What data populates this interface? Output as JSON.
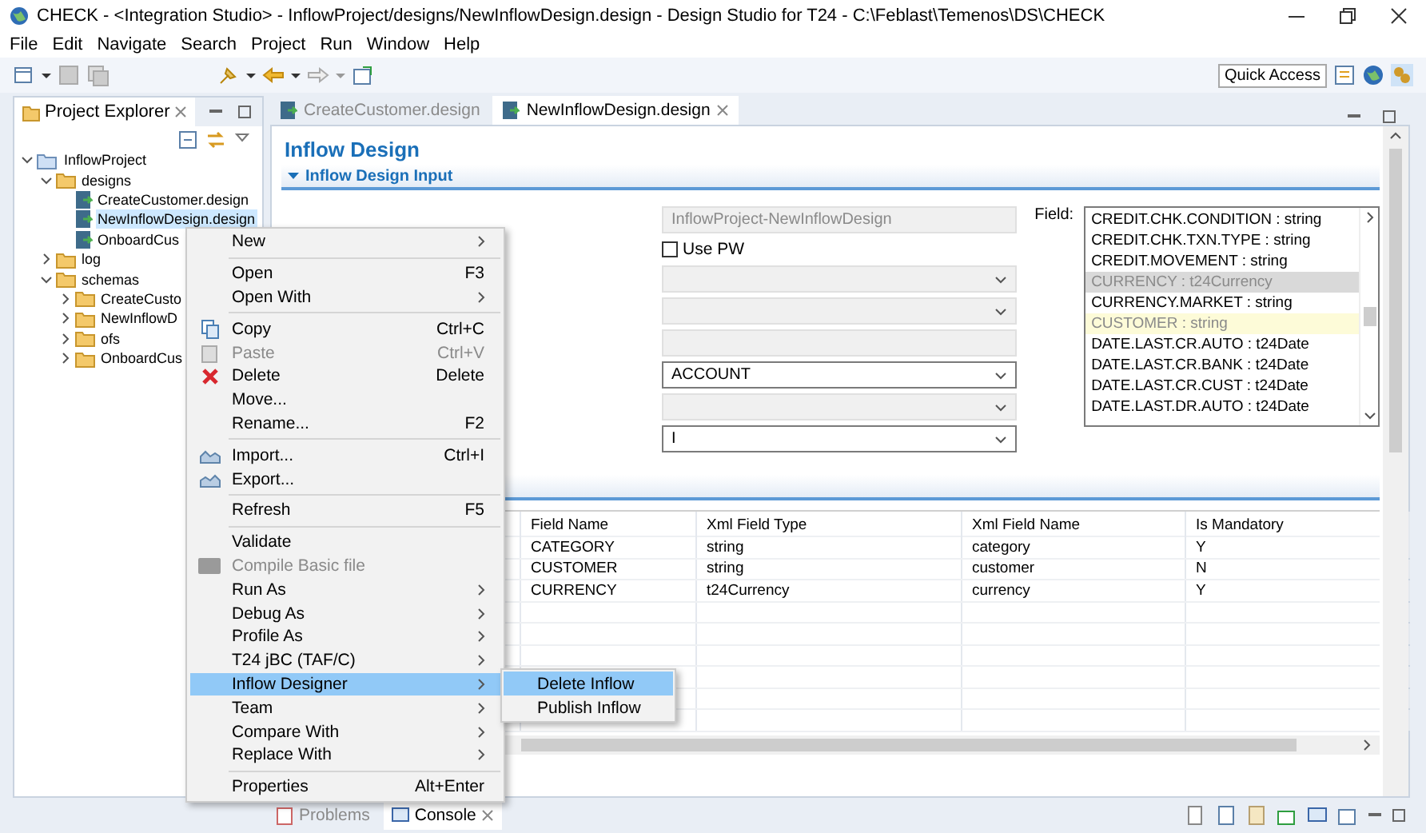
{
  "window": {
    "title": "CHECK - <Integration Studio> - InflowProject/designs/NewInflowDesign.design - Design Studio for T24 - C:\\Feblast\\Temenos\\DS\\CHECK"
  },
  "menu_bar": [
    "File",
    "Edit",
    "Navigate",
    "Search",
    "Project",
    "Run",
    "Window",
    "Help"
  ],
  "quick_access": "Quick Access",
  "project_explorer": {
    "title": "Project Explorer",
    "tree": [
      {
        "label": "InflowProject",
        "kind": "project",
        "expanded": true,
        "selected": false,
        "children": [
          {
            "label": "designs",
            "kind": "folder",
            "expanded": true,
            "selected": false,
            "children": [
              {
                "label": "CreateCustomer.design",
                "kind": "file",
                "selected": false
              },
              {
                "label": "NewInflowDesign.design",
                "kind": "file",
                "selected": true
              },
              {
                "label": "OnboardCus",
                "kind": "file",
                "selected": false
              }
            ]
          },
          {
            "label": "log",
            "kind": "folder",
            "expanded": false,
            "selected": false
          },
          {
            "label": "schemas",
            "kind": "folder",
            "expanded": true,
            "selected": false,
            "children": [
              {
                "label": "CreateCusto",
                "kind": "folder",
                "expanded": false,
                "selected": false
              },
              {
                "label": "NewInflowD",
                "kind": "folder",
                "expanded": false,
                "selected": false
              },
              {
                "label": "ofs",
                "kind": "folder",
                "expanded": false,
                "selected": false
              },
              {
                "label": "OnboardCus",
                "kind": "folder",
                "expanded": false,
                "selected": false
              }
            ]
          }
        ]
      }
    ]
  },
  "editor": {
    "tabs": [
      {
        "label": "CreateCustomer.design",
        "selected": false
      },
      {
        "label": "NewInflowDesign.design",
        "selected": true
      }
    ],
    "title": "Inflow Design",
    "section": "Inflow Design Input",
    "form": [
      {
        "kind": "text",
        "value": "InflowProject-NewInflowDesign",
        "disabled": true
      },
      {
        "kind": "checkbox",
        "label": "Use PW",
        "checked": false
      },
      {
        "kind": "dropdown",
        "disabled": true
      },
      {
        "kind": "dropdown",
        "disabled": true
      },
      {
        "kind": "text",
        "disabled": true
      },
      {
        "kind": "dropdown",
        "value": "ACCOUNT",
        "disabled": false
      },
      {
        "kind": "dropdown",
        "disabled": true
      },
      {
        "kind": "dropdown",
        "value": "I",
        "disabled": false
      }
    ],
    "field_list": {
      "label": "Field:",
      "items": [
        {
          "label": "CREDIT.CHK.CONDITION : string",
          "selected": false,
          "used": false
        },
        {
          "label": "CREDIT.CHK.TXN.TYPE : string",
          "selected": false,
          "used": false
        },
        {
          "label": "CREDIT.MOVEMENT : string",
          "selected": false,
          "used": false
        },
        {
          "label": "CURRENCY : t24Currency",
          "selected": true,
          "used": true
        },
        {
          "label": "CURRENCY.MARKET : string",
          "selected": false,
          "used": false
        },
        {
          "label": "CUSTOMER : string",
          "selected": false,
          "used": true
        },
        {
          "label": "DATE.LAST.CR.AUTO : t24Date",
          "selected": false,
          "used": false
        },
        {
          "label": "DATE.LAST.CR.BANK : t24Date",
          "selected": false,
          "used": false
        },
        {
          "label": "DATE.LAST.CR.CUST : t24Date",
          "selected": false,
          "used": false
        },
        {
          "label": "DATE.LAST.DR.AUTO : t24Date",
          "selected": false,
          "used": false
        }
      ]
    },
    "table": {
      "columns": [
        "Field Name",
        "Xml Field Type",
        "Xml Field Name",
        "Is Mandatory"
      ],
      "rows": [
        [
          "CATEGORY",
          "string",
          "category",
          "Y"
        ],
        [
          "CUSTOMER",
          "string",
          "customer",
          "N"
        ],
        [
          "CURRENCY",
          "t24Currency",
          "currency",
          "Y"
        ]
      ]
    }
  },
  "bottom_tabs": [
    {
      "label": "Problems",
      "selected": false
    },
    {
      "label": "Console",
      "selected": true
    }
  ],
  "context_menu": [
    {
      "kind": "item",
      "label": "New",
      "submenu": true
    },
    {
      "kind": "separator"
    },
    {
      "kind": "item",
      "label": "Open",
      "shortcut": "F3"
    },
    {
      "kind": "item",
      "label": "Open With",
      "submenu": true
    },
    {
      "kind": "separator"
    },
    {
      "kind": "item",
      "label": "Copy",
      "shortcut": "Ctrl+C"
    },
    {
      "kind": "item",
      "label": "Paste",
      "shortcut": "Ctrl+V",
      "disabled": true
    },
    {
      "kind": "item",
      "label": "Delete",
      "shortcut": "Delete"
    },
    {
      "kind": "item",
      "label": "Move..."
    },
    {
      "kind": "item",
      "label": "Rename...",
      "shortcut": "F2"
    },
    {
      "kind": "separator"
    },
    {
      "kind": "item",
      "label": "Import...",
      "shortcut": "Ctrl+I"
    },
    {
      "kind": "item",
      "label": "Export..."
    },
    {
      "kind": "separator"
    },
    {
      "kind": "item",
      "label": "Refresh",
      "shortcut": "F5"
    },
    {
      "kind": "separator"
    },
    {
      "kind": "item",
      "label": "Validate"
    },
    {
      "kind": "item",
      "label": "Compile Basic file",
      "disabled": true
    },
    {
      "kind": "item",
      "label": "Run As",
      "submenu": true
    },
    {
      "kind": "item",
      "label": "Debug As",
      "submenu": true
    },
    {
      "kind": "item",
      "label": "Profile As",
      "submenu": true
    },
    {
      "kind": "item",
      "label": "T24 jBC (TAF/C)",
      "submenu": true
    },
    {
      "kind": "item",
      "label": "Inflow Designer",
      "submenu": true,
      "selected": true
    },
    {
      "kind": "item",
      "label": "Team",
      "submenu": true
    },
    {
      "kind": "item",
      "label": "Compare With",
      "submenu": true
    },
    {
      "kind": "item",
      "label": "Replace With",
      "submenu": true
    },
    {
      "kind": "separator"
    },
    {
      "kind": "item",
      "label": "Properties",
      "shortcut": "Alt+Enter"
    }
  ],
  "submenu": [
    {
      "label": "Delete Inflow",
      "selected": true
    },
    {
      "label": "Publish Inflow",
      "selected": false
    }
  ]
}
